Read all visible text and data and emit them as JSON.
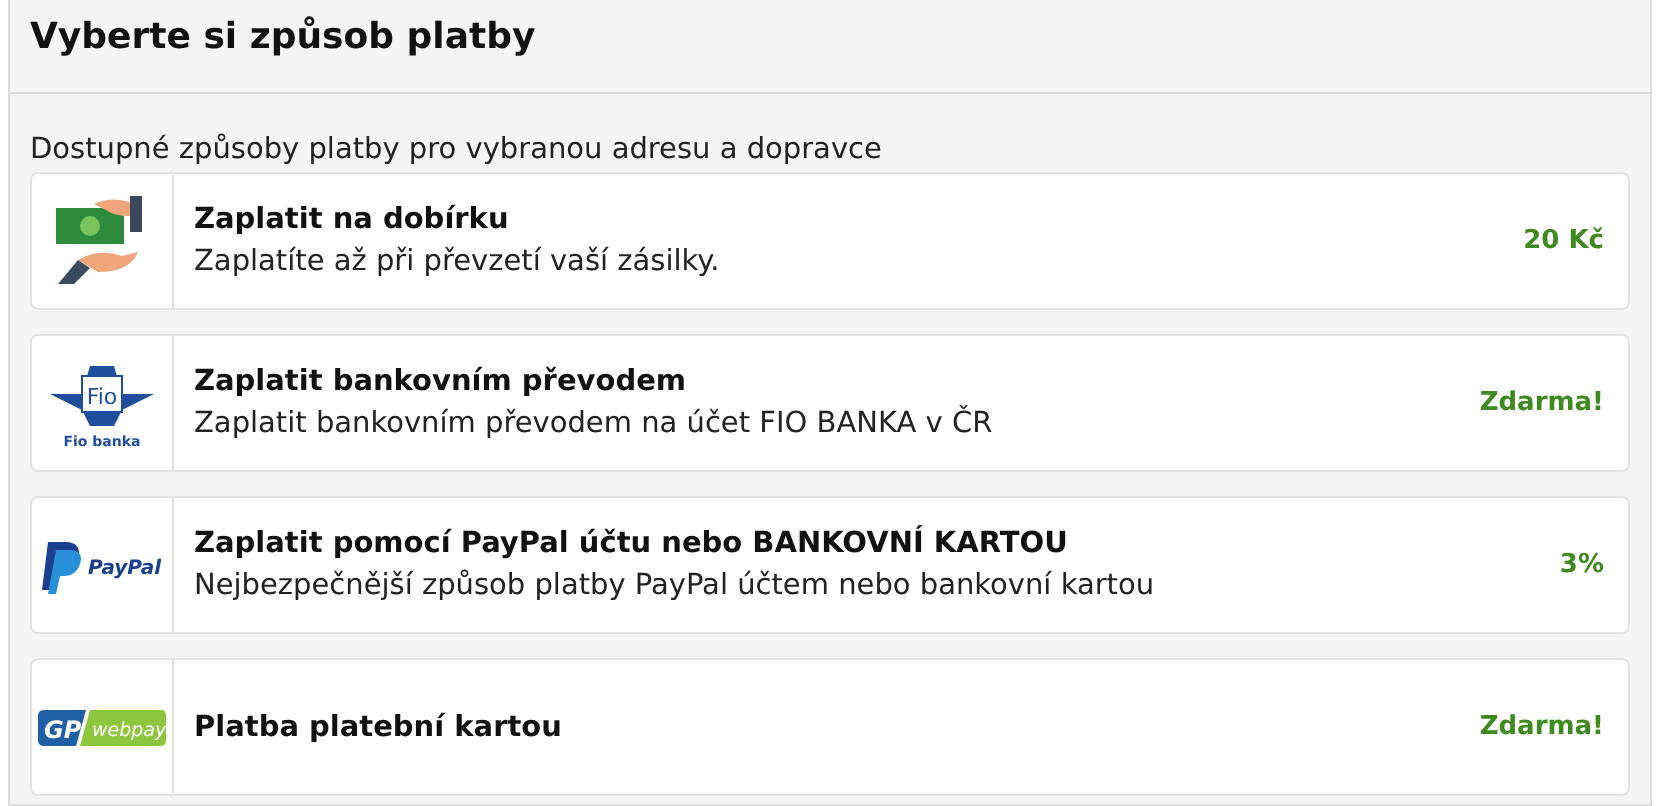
{
  "title": "Vyberte si způsob platby",
  "subtitle": "Dostupné způsoby platby pro vybranou adresu a dopravce",
  "methods": [
    {
      "logo": {
        "kind": "cash"
      },
      "name": "Zaplatit na dobírku",
      "description": "Zaplatíte až při převzetí vaší zásilky.",
      "price": "20 Kč"
    },
    {
      "logo": {
        "kind": "fio",
        "texts": [
          "Fio",
          "Fio banka"
        ]
      },
      "name": "Zaplatit bankovním převodem",
      "description": "Zaplatit bankovním převodem na účet FIO BANKA v ČR",
      "price": "Zdarma!"
    },
    {
      "logo": {
        "kind": "paypal",
        "texts": [
          "PayPal"
        ]
      },
      "name": "Zaplatit pomocí PayPal účtu nebo BANKOVNÍ KARTOU",
      "description": "Nejbezpečnější způsob platby PayPal účtem nebo bankovní kartou",
      "price": "3%"
    },
    {
      "logo": {
        "kind": "gp",
        "texts": [
          "GP",
          "webpay"
        ]
      },
      "name": "Platba platební kartou",
      "price": "Zdarma!"
    }
  ]
}
